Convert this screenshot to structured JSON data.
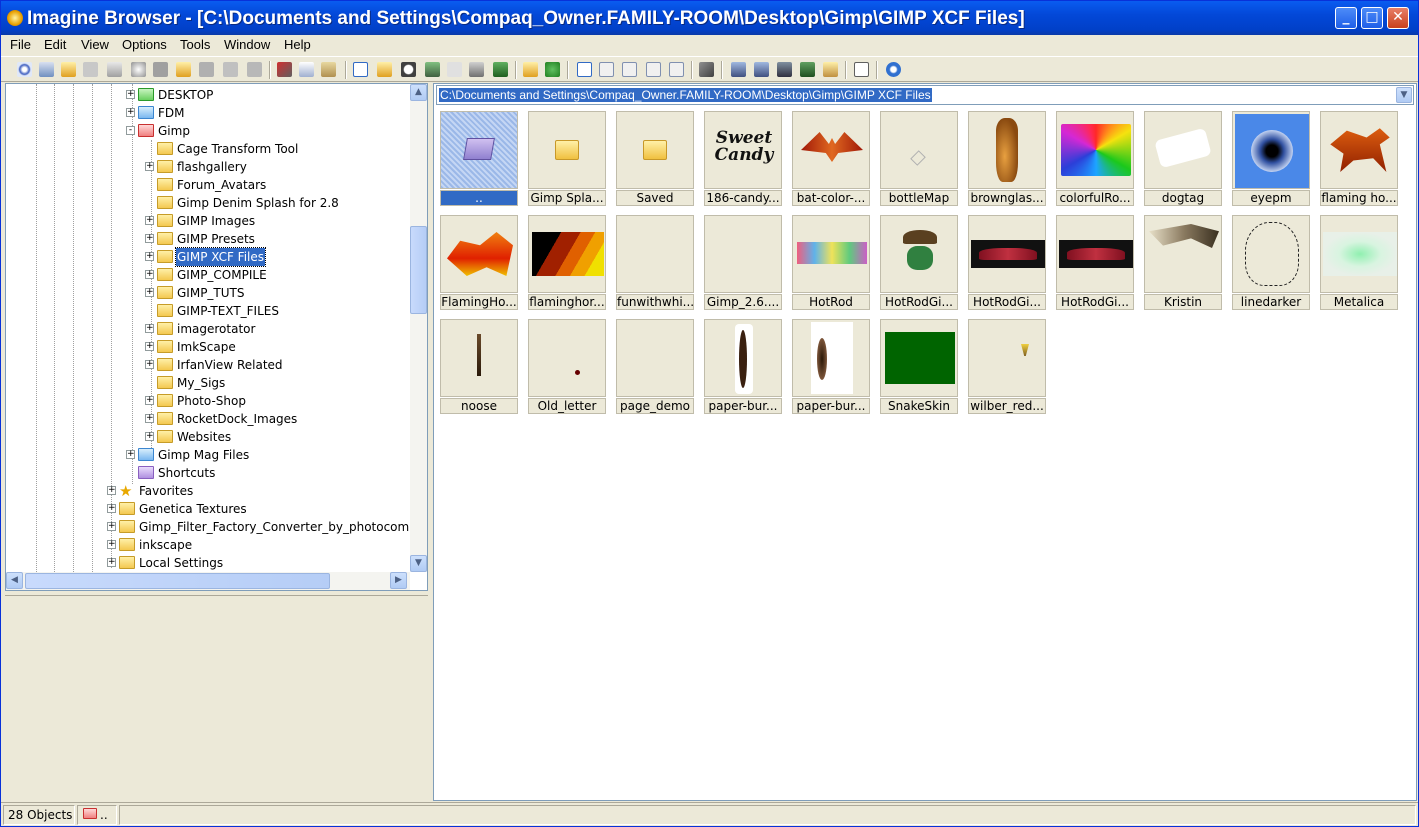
{
  "window": {
    "title": "Imagine Browser - [C:\\Documents and Settings\\Compaq_Owner.FAMILY-ROOM\\Desktop\\Gimp\\GIMP XCF Files]",
    "minimize": "_",
    "maximize": "□",
    "close": "✕"
  },
  "menu": [
    "File",
    "Edit",
    "View",
    "Options",
    "Tools",
    "Window",
    "Help"
  ],
  "tree": {
    "items": [
      {
        "label": "DESKTOP",
        "level": 3,
        "expander": "+",
        "color": "green"
      },
      {
        "label": "FDM",
        "level": 3,
        "expander": "+",
        "color": "blue"
      },
      {
        "label": "Gimp",
        "level": 3,
        "expander": "−",
        "color": "red"
      },
      {
        "label": "Cage Transform Tool",
        "level": 4,
        "expander": "",
        "color": "yellow"
      },
      {
        "label": "flashgallery",
        "level": 4,
        "expander": "+",
        "color": "yellow"
      },
      {
        "label": "Forum_Avatars",
        "level": 4,
        "expander": "",
        "color": "yellow"
      },
      {
        "label": "Gimp Denim Splash for 2.8",
        "level": 4,
        "expander": "",
        "color": "yellow"
      },
      {
        "label": "GIMP Images",
        "level": 4,
        "expander": "+",
        "color": "yellow"
      },
      {
        "label": "GIMP Presets",
        "level": 4,
        "expander": "+",
        "color": "yellow"
      },
      {
        "label": "GIMP XCF Files",
        "level": 4,
        "expander": "+",
        "color": "yellow",
        "selected": true
      },
      {
        "label": "GIMP_COMPILE",
        "level": 4,
        "expander": "+",
        "color": "yellow"
      },
      {
        "label": "GIMP_TUTS",
        "level": 4,
        "expander": "+",
        "color": "yellow"
      },
      {
        "label": "GIMP-TEXT_FILES",
        "level": 4,
        "expander": "",
        "color": "yellow"
      },
      {
        "label": "imagerotator",
        "level": 4,
        "expander": "+",
        "color": "yellow"
      },
      {
        "label": "ImkScape",
        "level": 4,
        "expander": "+",
        "color": "yellow"
      },
      {
        "label": "IrfanView Related",
        "level": 4,
        "expander": "+",
        "color": "yellow"
      },
      {
        "label": "My_Sigs",
        "level": 4,
        "expander": "",
        "color": "yellow"
      },
      {
        "label": "Photo-Shop",
        "level": 4,
        "expander": "+",
        "color": "yellow"
      },
      {
        "label": "RocketDock_Images",
        "level": 4,
        "expander": "+",
        "color": "yellow"
      },
      {
        "label": "Websites",
        "level": 4,
        "expander": "+",
        "color": "yellow"
      },
      {
        "label": "Gimp Mag Files",
        "level": 3,
        "expander": "+",
        "color": "blue"
      },
      {
        "label": "Shortcuts",
        "level": 3,
        "expander": "",
        "color": "purple"
      },
      {
        "label": "Favorites",
        "level": 2,
        "expander": "+",
        "color": "star"
      },
      {
        "label": "Genetica Textures",
        "level": 2,
        "expander": "+",
        "color": "yellow"
      },
      {
        "label": "Gimp_Filter_Factory_Converter_by_photocomi",
        "level": 2,
        "expander": "+",
        "color": "yellow"
      },
      {
        "label": "inkscape",
        "level": 2,
        "expander": "+",
        "color": "yellow"
      },
      {
        "label": "Local Settings",
        "level": 2,
        "expander": "+",
        "color": "yellow"
      }
    ]
  },
  "path": "C:\\Documents and Settings\\Compaq_Owner.FAMILY-ROOM\\Desktop\\Gimp\\GIMP XCF Files",
  "thumbnails": [
    {
      "caption": "..",
      "kind": "parent"
    },
    {
      "caption": "Gimp Spla...",
      "kind": "folder"
    },
    {
      "caption": "Saved",
      "kind": "folder"
    },
    {
      "caption": "186-candy...",
      "kind": "candy",
      "text": "Sweet Candy"
    },
    {
      "caption": "bat-color-...",
      "kind": "bat"
    },
    {
      "caption": "bottleMap",
      "kind": "bottlemap"
    },
    {
      "caption": "brownglas...",
      "kind": "jug"
    },
    {
      "caption": "colorfulRo...",
      "kind": "swirl"
    },
    {
      "caption": "dogtag",
      "kind": "dogtag"
    },
    {
      "caption": "eyepm",
      "kind": "eye"
    },
    {
      "caption": "flaming ho...",
      "kind": "horse"
    },
    {
      "caption": "FlamingHo...",
      "kind": "flamehorse"
    },
    {
      "caption": "flaminghor...",
      "kind": "stripes"
    },
    {
      "caption": "funwithwhi...",
      "kind": "blank"
    },
    {
      "caption": "Gimp_2.6....",
      "kind": "blank"
    },
    {
      "caption": "HotRod",
      "kind": "hotrod"
    },
    {
      "caption": "HotRodGi...",
      "kind": "hat"
    },
    {
      "caption": "HotRodGi...",
      "kind": "car"
    },
    {
      "caption": "HotRodGi...",
      "kind": "car"
    },
    {
      "caption": "Kristin",
      "kind": "kristin"
    },
    {
      "caption": "linedarker",
      "kind": "sketch"
    },
    {
      "caption": "Metalica",
      "kind": "metal"
    },
    {
      "caption": "noose",
      "kind": "noose"
    },
    {
      "caption": "Old_letter",
      "kind": "dot"
    },
    {
      "caption": "page_demo",
      "kind": "blank"
    },
    {
      "caption": "paper-bur...",
      "kind": "burn"
    },
    {
      "caption": "paper-bur...",
      "kind": "burn2"
    },
    {
      "caption": "SnakeSkin",
      "kind": "snake"
    },
    {
      "caption": "wilber_red...",
      "kind": "wilber"
    }
  ],
  "status": {
    "objects": "28 Objects",
    "folder": ".."
  },
  "colors": {
    "titlebar": "#0348d8",
    "selection": "#316ac5",
    "face": "#ece9d8"
  }
}
